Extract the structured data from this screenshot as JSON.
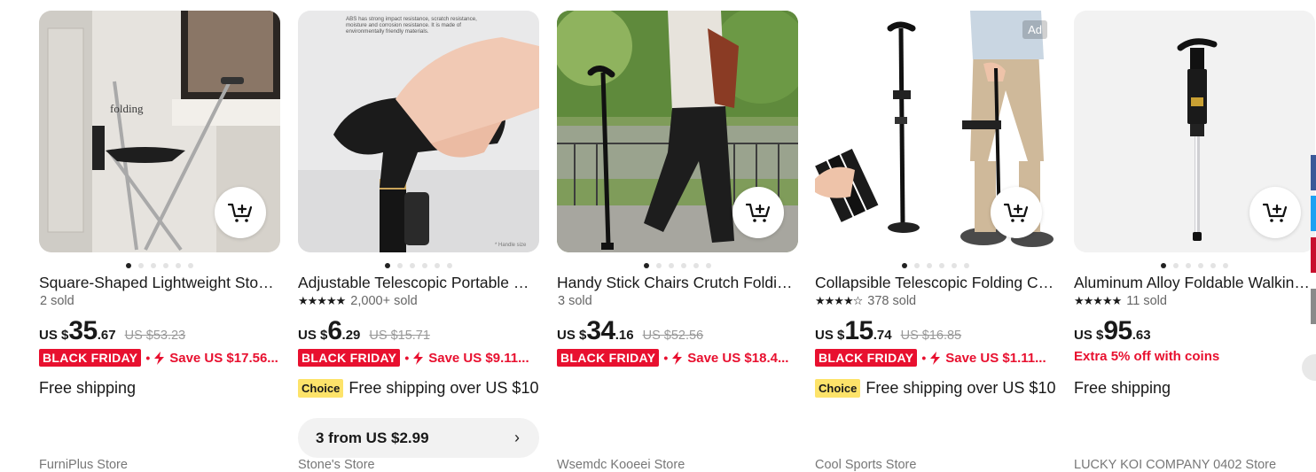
{
  "products": [
    {
      "title": "Square-Shaped Lightweight Stool Walking Stick Cane Seat",
      "rating_stars": "",
      "sold": "2 sold",
      "currency": "US $",
      "price_int": "35",
      "price_dec": ".67",
      "original_price": "US $53.23",
      "badge": "BLACK FRIDAY",
      "separator": "•",
      "save_text": "Save US $17.56...",
      "shipping": "Free shipping",
      "choice": "",
      "bundle": "",
      "store": "FurniPlus Store",
      "ad": "",
      "image_text": "folding"
    },
    {
      "title": "Adjustable Telescopic Portable Walking Cane",
      "rating_stars": "★★★★★",
      "sold": "2,000+ sold",
      "currency": "US $",
      "price_int": "6",
      "price_dec": ".29",
      "original_price": "US $15.71",
      "badge": "BLACK FRIDAY",
      "separator": "•",
      "save_text": "Save US $9.11...",
      "shipping": "Free shipping over US $10",
      "choice": "Choice",
      "bundle": "3 from US $2.99",
      "store": "Stone's Store",
      "ad": "",
      "image_text": "ABS has strong impact resistance, scratch resistance, moisture and corrosion resistance. It is made of environmentally friendly materials."
    },
    {
      "title": "Handy Stick Chairs Crutch Folding Cane Seat",
      "rating_stars": "",
      "sold": "3 sold",
      "currency": "US $",
      "price_int": "34",
      "price_dec": ".16",
      "original_price": "US $52.56",
      "badge": "BLACK FRIDAY",
      "separator": "•",
      "save_text": "Save US $18.4...",
      "shipping": "",
      "choice": "",
      "bundle": "",
      "store": "Wsemdc Kooeei Store",
      "ad": "",
      "image_text": ""
    },
    {
      "title": "Collapsible Telescopic Folding Cane with LED Light",
      "rating_stars": "★★★★☆",
      "sold": "378 sold",
      "currency": "US $",
      "price_int": "15",
      "price_dec": ".74",
      "original_price": "US $16.85",
      "badge": "BLACK FRIDAY",
      "separator": "•",
      "save_text": "Save US $1.11...",
      "shipping": "Free shipping over US $10",
      "choice": "Choice",
      "bundle": "",
      "store": "Cool Sports Store",
      "ad": "Ad",
      "image_text": ""
    },
    {
      "title": "Aluminum Alloy Foldable Walking Stick Seat",
      "rating_stars": "★★★★★",
      "sold": "11 sold",
      "currency": "US $",
      "price_int": "95",
      "price_dec": ".63",
      "original_price": "",
      "badge": "",
      "separator": "",
      "save_text": "",
      "extra": "Extra 5% off with coins",
      "shipping": "Free shipping",
      "choice": "",
      "bundle": "",
      "store": "LUCKY KOI COMPANY 0402 Store",
      "ad": "",
      "image_text": ""
    }
  ],
  "colors": {
    "sale_red": "#e8102f",
    "choice_yellow": "#fde36a"
  }
}
